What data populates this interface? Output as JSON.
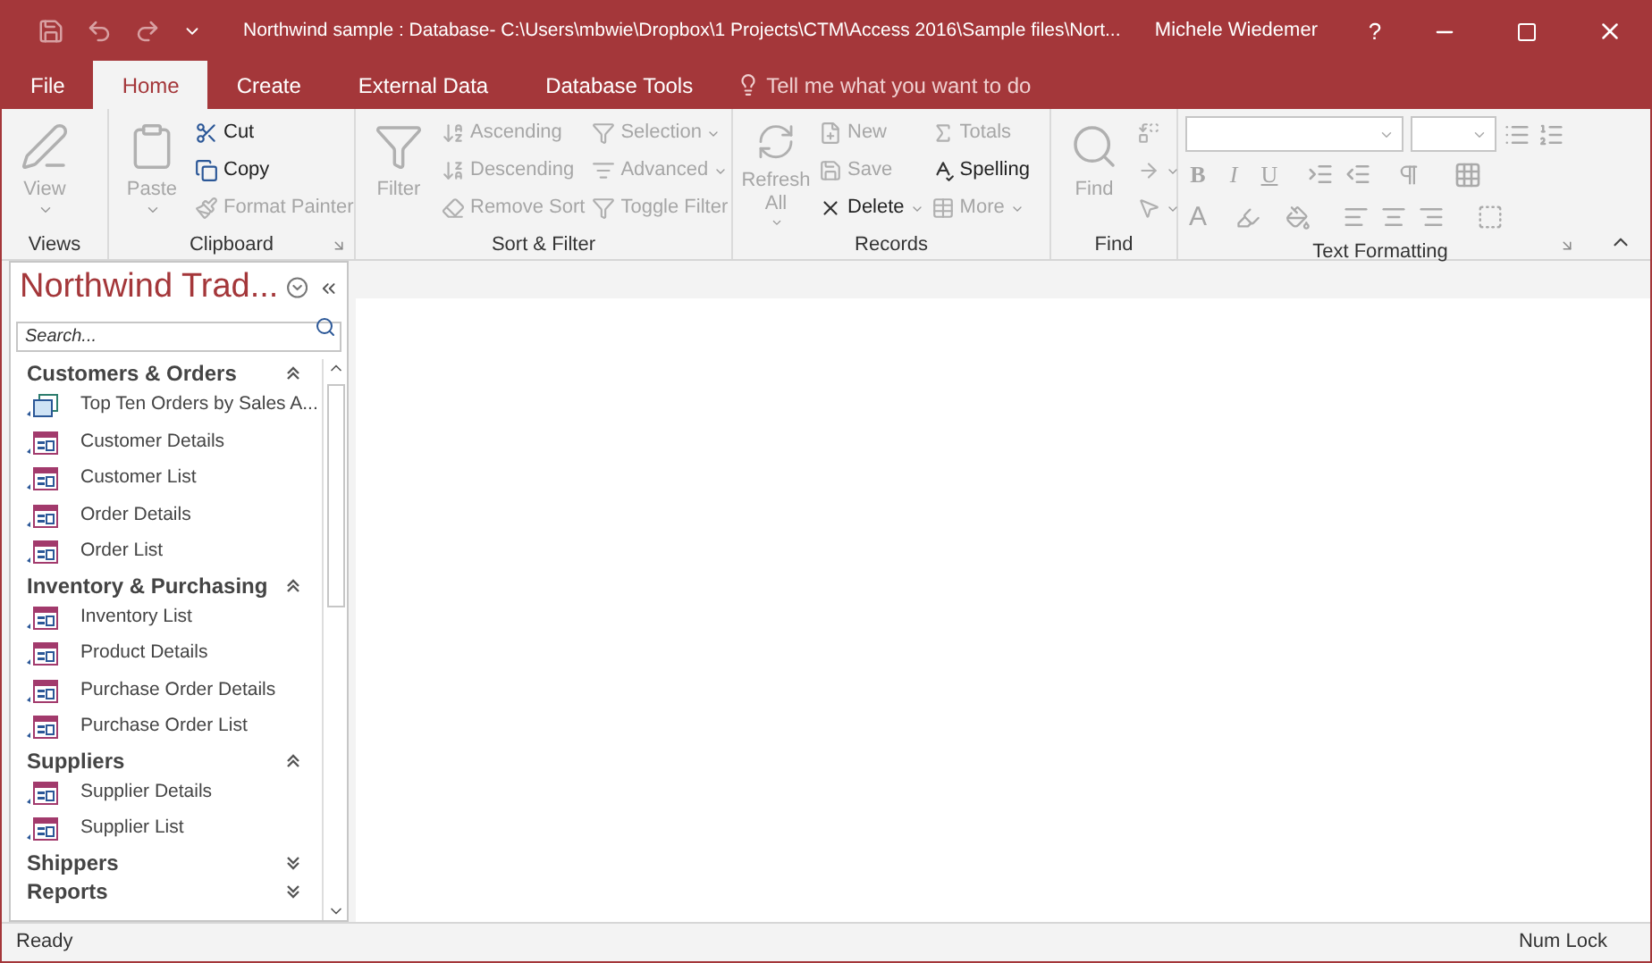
{
  "title_bar": {
    "title": "Northwind sample : Database- C:\\Users\\mbwie\\Dropbox\\1 Projects\\CTM\\Access 2016\\Sample files\\Nort...",
    "user": "Michele Wiedemer",
    "help": "?"
  },
  "tabs": [
    {
      "label": "File",
      "selected": false
    },
    {
      "label": "Home",
      "selected": true
    },
    {
      "label": "Create",
      "selected": false
    },
    {
      "label": "External Data",
      "selected": false
    },
    {
      "label": "Database Tools",
      "selected": false
    }
  ],
  "tell_me": "Tell me what you want to do",
  "ribbon": {
    "groups": [
      {
        "label": "Views",
        "launcher": false,
        "columns": [
          [
            {
              "label": "View",
              "kind": "large",
              "disabled": true,
              "dropdown": true
            }
          ]
        ]
      },
      {
        "label": "Clipboard",
        "launcher": true,
        "columns": [
          [
            {
              "label": "Paste",
              "kind": "large",
              "disabled": true,
              "dropdown": true
            }
          ],
          [
            {
              "label": "Cut",
              "kind": "small",
              "disabled": false,
              "dropdown": false
            },
            {
              "label": "Copy",
              "kind": "small",
              "disabled": false,
              "dropdown": false
            },
            {
              "label": "Format Painter",
              "kind": "small",
              "disabled": true,
              "dropdown": false
            }
          ]
        ]
      },
      {
        "label": "Sort & Filter",
        "launcher": false,
        "columns": [
          [
            {
              "label": "Filter",
              "kind": "large",
              "disabled": true,
              "dropdown": false
            }
          ],
          [
            {
              "label": "Ascending",
              "kind": "small",
              "disabled": true,
              "dropdown": false
            },
            {
              "label": "Descending",
              "kind": "small",
              "disabled": true,
              "dropdown": false
            },
            {
              "label": "Remove Sort",
              "kind": "small",
              "disabled": true,
              "dropdown": false
            }
          ],
          [
            {
              "label": "Selection",
              "kind": "small",
              "disabled": true,
              "dropdown": true
            },
            {
              "label": "Advanced",
              "kind": "small",
              "disabled": true,
              "dropdown": true
            },
            {
              "label": "Toggle Filter",
              "kind": "small",
              "disabled": true,
              "dropdown": false
            }
          ]
        ]
      },
      {
        "label": "Records",
        "launcher": false,
        "columns": [
          [
            {
              "label": "Refresh All",
              "kind": "large",
              "disabled": true,
              "dropdown": true
            }
          ],
          [
            {
              "label": "New",
              "kind": "small",
              "disabled": true,
              "dropdown": false
            },
            {
              "label": "Save",
              "kind": "small",
              "disabled": true,
              "dropdown": false
            },
            {
              "label": "Delete",
              "kind": "small",
              "disabled": false,
              "dropdown": true
            }
          ],
          [
            {
              "label": "Totals",
              "kind": "small",
              "disabled": true,
              "dropdown": false
            },
            {
              "label": "Spelling",
              "kind": "small",
              "disabled": false,
              "dropdown": false
            },
            {
              "label": "More",
              "kind": "small",
              "disabled": true,
              "dropdown": true
            }
          ]
        ]
      },
      {
        "label": "Find",
        "launcher": false,
        "columns": [
          [
            {
              "label": "Find",
              "kind": "large",
              "disabled": true,
              "dropdown": false
            }
          ],
          [
            {
              "kind": "small",
              "disabled": true,
              "dropdown": false
            },
            {
              "kind": "small",
              "disabled": true,
              "dropdown": true
            },
            {
              "kind": "small",
              "disabled": true,
              "dropdown": true
            }
          ]
        ]
      }
    ],
    "text_formatting": {
      "label": "Text Formatting",
      "launcher": true,
      "glyphs": [
        "B",
        "I",
        "U",
        "A"
      ]
    }
  },
  "nav_pane": {
    "title": "Northwind Trad...",
    "search_placeholder": "Search...",
    "groups": [
      {
        "label": "Customers & Orders",
        "expanded": true,
        "items": [
          {
            "label": "Top Ten Orders by Sales A...",
            "kind": "report"
          },
          {
            "label": "Customer Details",
            "kind": "form"
          },
          {
            "label": "Customer List",
            "kind": "form"
          },
          {
            "label": "Order Details",
            "kind": "form"
          },
          {
            "label": "Order List",
            "kind": "form"
          }
        ]
      },
      {
        "label": "Inventory & Purchasing",
        "expanded": true,
        "items": [
          {
            "label": "Inventory List",
            "kind": "form"
          },
          {
            "label": "Product Details",
            "kind": "form"
          },
          {
            "label": "Purchase Order Details",
            "kind": "form"
          },
          {
            "label": "Purchase Order List",
            "kind": "form"
          }
        ]
      },
      {
        "label": "Suppliers",
        "expanded": true,
        "items": [
          {
            "label": "Supplier Details",
            "kind": "form"
          },
          {
            "label": "Supplier List",
            "kind": "form"
          }
        ]
      },
      {
        "label": "Shippers",
        "expanded": false
      },
      {
        "label": "Reports",
        "expanded": false
      }
    ]
  },
  "status_bar": {
    "left": "Ready",
    "right": "Num Lock"
  }
}
